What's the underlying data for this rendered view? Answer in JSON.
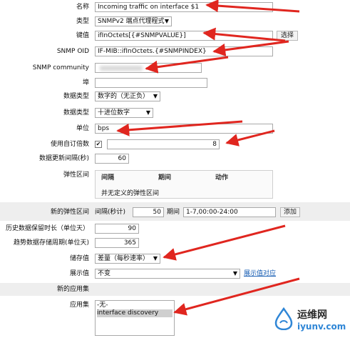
{
  "fields": {
    "name": {
      "label": "名称",
      "value": "Incoming traffic on interface $1"
    },
    "type": {
      "label": "类型",
      "value": "SNMPv2 端点代理程式"
    },
    "key": {
      "label": "键值",
      "value": "ifInOctets[{#SNMPVALUE}]",
      "button": "选择"
    },
    "oid": {
      "label": "SNMP OID",
      "value": "IF-MIB::ifInOctets.{#SNMPINDEX}"
    },
    "community": {
      "label": "SNMP community",
      "value": ""
    },
    "port": {
      "label": "埠",
      "value": ""
    },
    "datatype": {
      "label": "数据类型",
      "value": "数字的（无正负）"
    },
    "dataformat": {
      "label": "数据类型",
      "value": "十进位数字"
    },
    "units": {
      "label": "单位",
      "value": "bps"
    },
    "multiplier": {
      "label": "使用自订倍数",
      "checked": true,
      "value": "8"
    },
    "interval": {
      "label": "数据更新间隔(秒)",
      "value": "60"
    },
    "flexible": {
      "label": "弹性区间",
      "col_interval": "间隔",
      "col_period": "期间",
      "col_action": "动作",
      "empty": "并无定义的弹性区间"
    },
    "new_flexible": {
      "label": "新的弹性区间",
      "interval_label": "间隔(秒计)",
      "interval_value": "50",
      "period_label": "期间",
      "period_value": "1-7,00:00-24:00",
      "add_button": "添加"
    },
    "history": {
      "label": "历史数据保留时长（单位天）",
      "value": "90"
    },
    "trends": {
      "label": "趋势数据存储周期(单位天)",
      "value": "365"
    },
    "store": {
      "label": "储存值",
      "value": "差量（每秒速率）"
    },
    "show": {
      "label": "展示值",
      "value": "不变",
      "link": "展示值对应"
    },
    "new_app": {
      "label": "新的应用集"
    },
    "apps": {
      "label": "应用集",
      "options": [
        "-无-",
        "interface discovery"
      ]
    }
  },
  "watermark": {
    "brand": "运维网",
    "url": "iyunv.com"
  },
  "colors": {
    "arrow": "#e0261f",
    "shade": "#eeeeee",
    "link": "#1a5fb4",
    "selected_option": "#cfcfcf",
    "watermark_blue": "#2f86d6"
  }
}
